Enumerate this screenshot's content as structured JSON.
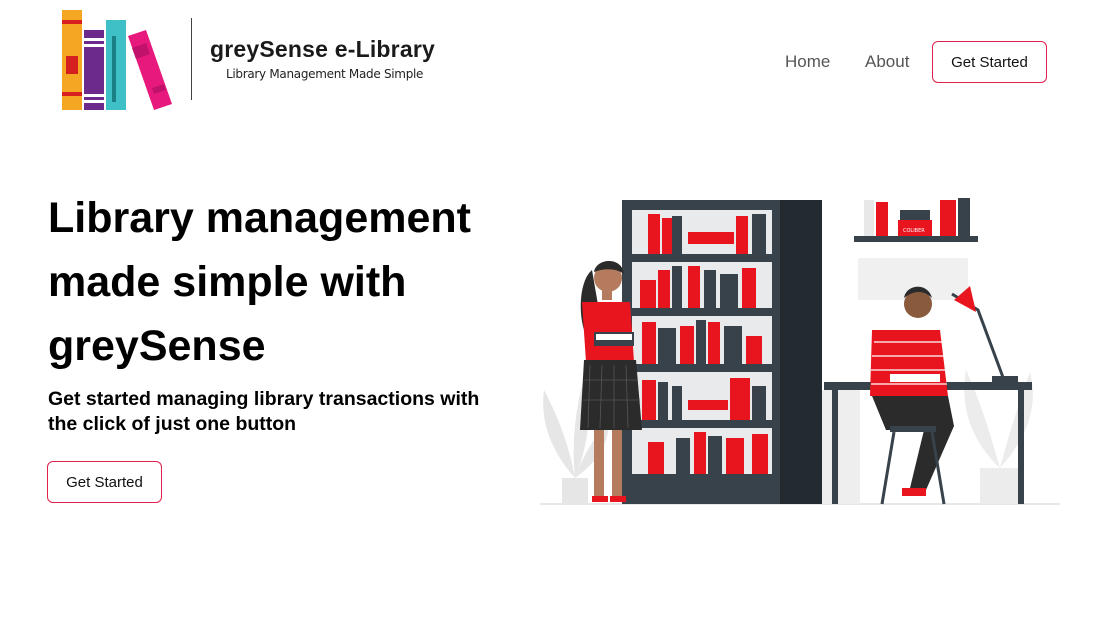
{
  "header": {
    "brand_title": "greySense e-Library",
    "brand_tagline": "Library Management Made Simple",
    "logo_icon": "books-logo-icon"
  },
  "nav": {
    "items": [
      {
        "label": "Home"
      },
      {
        "label": "About"
      }
    ],
    "cta_label": "Get Started"
  },
  "hero": {
    "title": "Library management made simple with greySense",
    "subtitle": "Get started managing library transactions with the click of just one button",
    "cta_label": "Get Started",
    "illustration_icon": "library-reading-illustration-icon",
    "illustration_book_label": "COLIBER"
  },
  "colors": {
    "accent": "#e0204a",
    "book_red": "#e8141e",
    "shelf_dark": "#37424a",
    "nav_text": "#555555"
  }
}
